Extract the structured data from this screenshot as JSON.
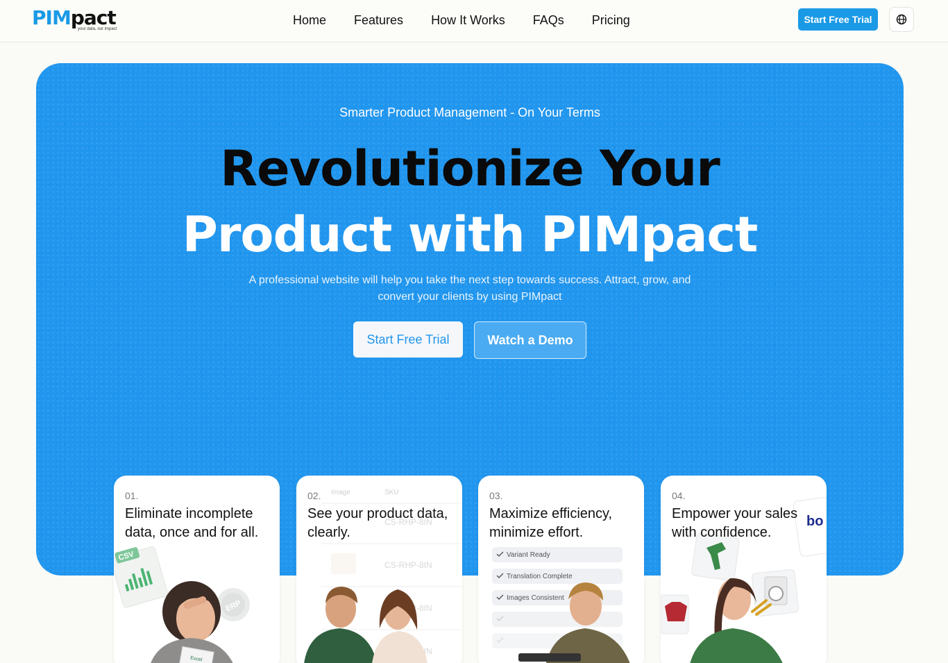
{
  "header": {
    "logo": {
      "pim": "PIM",
      "pact": "pact",
      "tagline": "your data, our impact"
    },
    "nav": [
      "Home",
      "Features",
      "How It Works",
      "FAQs",
      "Pricing"
    ],
    "cta_label": "Start Free Trial",
    "language_icon": "globe-icon"
  },
  "hero": {
    "eyebrow": "Smarter Product Management - On Your Terms",
    "headline_line1": "Revolutionize Your",
    "headline_line2": "Product with PIMpact",
    "subtext": "A professional website will help you take the next step towards success. Attract, grow, and convert your clients by using PIMpact",
    "primary_button": "Start Free Trial",
    "secondary_button": "Watch a Demo",
    "background_color": "#2196ee"
  },
  "cards": [
    {
      "number": "01.",
      "title": "Eliminate incomplete data, once and for all.",
      "art": {
        "badge_csv": "CSV",
        "badge_erp": "ERP",
        "paper_label": "Excel"
      }
    },
    {
      "number": "02.",
      "title": "See your product data, clearly.",
      "art": {
        "col_image": "Image",
        "col_sku": "SKU",
        "skus": [
          "CS-RHP-8IN",
          "CS-RHP-8IN",
          "CS-RHP-8IN",
          "CS-RHP-8IN"
        ]
      }
    },
    {
      "number": "03.",
      "title": "Maximize efficiency, minimize effort.",
      "art": {
        "checks": [
          "Variant Ready",
          "Translation Complete",
          "Images Consistent",
          "",
          ""
        ]
      }
    },
    {
      "number": "04.",
      "title": "Empower your sales with confidence.",
      "art": {
        "brand_fragment": "bo"
      }
    }
  ]
}
